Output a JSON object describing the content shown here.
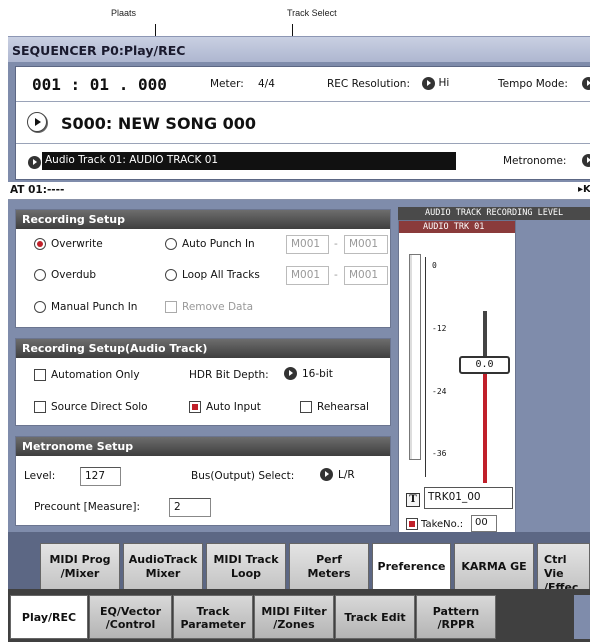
{
  "callouts": {
    "plaats": "Plaats",
    "track_select": "Track Select"
  },
  "title": "SEQUENCER P0:Play/REC",
  "info": {
    "location": "001 : 01 . 000",
    "meter_label": "Meter:",
    "meter_value": "4/4",
    "rec_res_label": "REC Resolution:",
    "rec_res_value": "Hi",
    "tempo_mode_label": "Tempo Mode:",
    "song_name": "S000: NEW SONG 000",
    "track_select": "Audio Track 01: AUDIO TRACK 01",
    "metronome_label": "Metronome:"
  },
  "at_bar": {
    "label": "AT 01:----",
    "right": "K"
  },
  "recording_setup": {
    "title": "Recording Setup",
    "overwrite": "Overwrite",
    "overdub": "Overdub",
    "manual_punch_in": "Manual Punch In",
    "auto_punch_in": "Auto Punch In",
    "loop_all_tracks": "Loop All Tracks",
    "remove_data": "Remove Data",
    "punch_from": "M001",
    "punch_to": "M001",
    "loop_from": "M001",
    "loop_to": "M001",
    "dash": "-"
  },
  "audio_setup": {
    "title": "Recording Setup(Audio Track)",
    "automation_only": "Automation Only",
    "hdr_label": "HDR Bit Depth:",
    "hdr_value": "16-bit",
    "source_direct_solo": "Source Direct Solo",
    "auto_input": "Auto Input",
    "rehearsal": "Rehearsal"
  },
  "metronome_setup": {
    "title": "Metronome Setup",
    "level_label": "Level:",
    "level_value": "127",
    "bus_label": "Bus(Output) Select:",
    "bus_value": "L/R",
    "precount_label": "Precount [Measure]:",
    "precount_value": "2"
  },
  "level_meter": {
    "header": "AUDIO TRACK RECORDING LEVEL",
    "track": "AUDIO TRK 01",
    "scale": [
      "0",
      "-12",
      "-24",
      "-36"
    ],
    "fader_value": "0.0",
    "t_button": "T",
    "take_name": "TRK01_00",
    "take_label": "TakeNo.:",
    "take_no": "00"
  },
  "tabs_top": [
    {
      "line1": "MIDI Prog",
      "line2": "/Mixer"
    },
    {
      "line1": "AudioTrack",
      "line2": "Mixer"
    },
    {
      "line1": "MIDI Track",
      "line2": "Loop"
    },
    {
      "line1": "Perf",
      "line2": "Meters"
    },
    {
      "line1": "Preference",
      "line2": ""
    },
    {
      "line1": "KARMA GE",
      "line2": ""
    },
    {
      "line1": "Ctrl Vie",
      "line2": "/Effec"
    }
  ],
  "tabs_bottom": [
    {
      "line1": "Play/REC",
      "line2": ""
    },
    {
      "line1": "EQ/Vector",
      "line2": "/Control"
    },
    {
      "line1": "Track",
      "line2": "Parameter"
    },
    {
      "line1": "MIDI Filter",
      "line2": "/Zones"
    },
    {
      "line1": "Track Edit",
      "line2": ""
    },
    {
      "line1": "Pattern",
      "line2": "/RPPR"
    }
  ]
}
